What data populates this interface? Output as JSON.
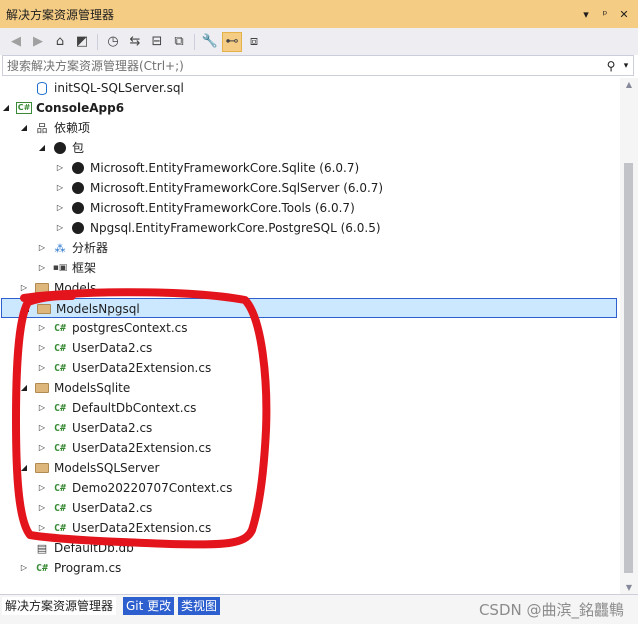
{
  "window": {
    "title": "解决方案资源管理器",
    "controls": {
      "dropdown": "▾",
      "pin": "ᵖ",
      "close": "✕"
    }
  },
  "toolbar": {
    "buttons": [
      {
        "name": "back-icon",
        "glyph": "◀",
        "disabled": true
      },
      {
        "name": "forward-icon",
        "glyph": "▶",
        "disabled": true
      },
      {
        "name": "home-icon",
        "glyph": "⌂"
      },
      {
        "name": "vs-switch-icon",
        "glyph": "◩"
      },
      {
        "name": "history-icon",
        "glyph": "◷"
      },
      {
        "name": "sync-icon",
        "glyph": "⇆"
      },
      {
        "name": "collapse-all-icon",
        "glyph": "⊟"
      },
      {
        "name": "show-all-files-icon",
        "glyph": "⧉"
      },
      {
        "name": "properties-icon",
        "glyph": "🔧"
      },
      {
        "name": "preview-icon",
        "glyph": "⊷",
        "active": true
      },
      {
        "name": "diagram-icon",
        "glyph": "⧈"
      }
    ]
  },
  "search": {
    "placeholder": "搜索解决方案资源管理器(Ctrl+;)",
    "icon_glyph": "⚲",
    "dropdown_glyph": "▾"
  },
  "tree": {
    "expanded_glyph": "◢",
    "collapsed_glyph": "▷",
    "items": [
      {
        "label": "initSQL-SQLServer.sql",
        "indent": 1,
        "expander": "none",
        "icon": "sql-file-icon"
      },
      {
        "label": "ConsoleApp6",
        "indent": 0,
        "expander": "expanded",
        "icon": "csharp-project-icon",
        "bold": true
      },
      {
        "label": "依赖项",
        "indent": 1,
        "expander": "expanded",
        "icon": "dependencies-icon"
      },
      {
        "label": "包",
        "indent": 2,
        "expander": "expanded",
        "icon": "package-icon"
      },
      {
        "label": "Microsoft.EntityFrameworkCore.Sqlite (6.0.7)",
        "indent": 3,
        "expander": "collapsed",
        "icon": "package-icon"
      },
      {
        "label": "Microsoft.EntityFrameworkCore.SqlServer (6.0.7)",
        "indent": 3,
        "expander": "collapsed",
        "icon": "package-icon"
      },
      {
        "label": "Microsoft.EntityFrameworkCore.Tools (6.0.7)",
        "indent": 3,
        "expander": "collapsed",
        "icon": "package-icon"
      },
      {
        "label": "Npgsql.EntityFrameworkCore.PostgreSQL (6.0.5)",
        "indent": 3,
        "expander": "collapsed",
        "icon": "package-icon"
      },
      {
        "label": "分析器",
        "indent": 2,
        "expander": "collapsed",
        "icon": "analyzer-icon"
      },
      {
        "label": "框架",
        "indent": 2,
        "expander": "collapsed",
        "icon": "framework-icon"
      },
      {
        "label": "Models",
        "indent": 1,
        "expander": "collapsed",
        "icon": "folder-icon"
      },
      {
        "label": "ModelsNpgsql",
        "indent": 1,
        "expander": "expanded",
        "icon": "folder-icon",
        "selected": true
      },
      {
        "label": "postgresContext.cs",
        "indent": 2,
        "expander": "collapsed",
        "icon": "csharp-file-icon"
      },
      {
        "label": "UserData2.cs",
        "indent": 2,
        "expander": "collapsed",
        "icon": "csharp-file-icon"
      },
      {
        "label": "UserData2Extension.cs",
        "indent": 2,
        "expander": "collapsed",
        "icon": "csharp-file-icon"
      },
      {
        "label": "ModelsSqlite",
        "indent": 1,
        "expander": "expanded",
        "icon": "folder-icon"
      },
      {
        "label": "DefaultDbContext.cs",
        "indent": 2,
        "expander": "collapsed",
        "icon": "csharp-file-icon"
      },
      {
        "label": "UserData2.cs",
        "indent": 2,
        "expander": "collapsed",
        "icon": "csharp-file-icon"
      },
      {
        "label": "UserData2Extension.cs",
        "indent": 2,
        "expander": "collapsed",
        "icon": "csharp-file-icon"
      },
      {
        "label": "ModelsSQLServer",
        "indent": 1,
        "expander": "expanded",
        "icon": "folder-icon"
      },
      {
        "label": "Demo20220707Context.cs",
        "indent": 2,
        "expander": "collapsed",
        "icon": "csharp-file-icon"
      },
      {
        "label": "UserData2.cs",
        "indent": 2,
        "expander": "collapsed",
        "icon": "csharp-file-icon"
      },
      {
        "label": "UserData2Extension.cs",
        "indent": 2,
        "expander": "collapsed",
        "icon": "csharp-file-icon"
      },
      {
        "label": "DefaultDb.db",
        "indent": 1,
        "expander": "none",
        "icon": "db-file-icon"
      },
      {
        "label": "Program.cs",
        "indent": 1,
        "expander": "collapsed",
        "icon": "csharp-file-icon"
      }
    ]
  },
  "icons": {
    "csharp_glyph": "C#",
    "dependencies_glyph": "品",
    "analyzer_glyph": "⁂",
    "framework_glyph": "▪▣",
    "db_glyph": "▤"
  },
  "bottom_tabs": [
    {
      "label": "解决方案资源管理器",
      "active": true
    },
    {
      "label": "Git 更改",
      "active": false
    },
    {
      "label": "类视图",
      "active": false
    }
  ],
  "watermark": "CSDN @曲滨_銘龘鶽",
  "colors": {
    "title_bar": "#f5cc84",
    "selection": "#cce8ff",
    "selection_border": "#2d5fcf",
    "folder": "#dcb67a",
    "csharp": "#388a34",
    "tab_inactive": "#2d5fcf",
    "annotation_red": "#e3141c"
  }
}
